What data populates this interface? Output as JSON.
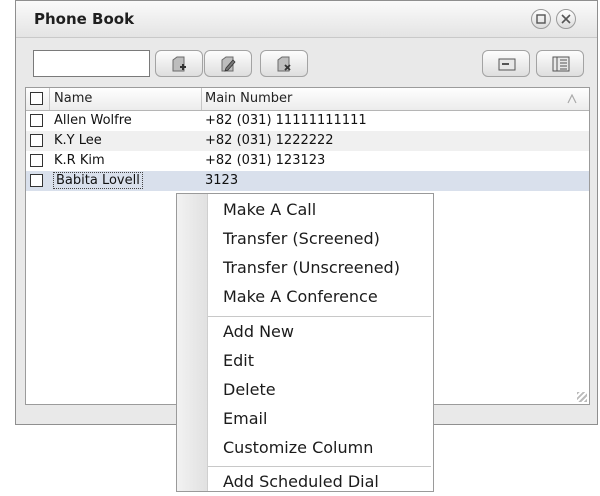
{
  "window": {
    "title": "Phone Book"
  },
  "titlebar_buttons": [
    {
      "name": "restore-button",
      "icon": "restore-icon"
    },
    {
      "name": "close-button",
      "icon": "close-icon"
    }
  ],
  "toolbar": {
    "search_value": "",
    "buttons": [
      {
        "name": "add-contact-button",
        "icon": "add-contact-icon"
      },
      {
        "name": "edit-contact-button",
        "icon": "edit-contact-icon"
      },
      {
        "name": "delete-contact-button",
        "icon": "delete-contact-icon"
      },
      {
        "name": "card-view-button",
        "icon": "card-view-icon"
      },
      {
        "name": "list-view-button",
        "icon": "list-view-icon"
      }
    ]
  },
  "grid": {
    "columns": [
      "Name",
      "Main Number"
    ],
    "rows": [
      {
        "name": "Allen Wolfre",
        "number": "+82 (031) 11111111111"
      },
      {
        "name": "K.Y Lee",
        "number": "+82 (031) 1222222"
      },
      {
        "name": "K.R Kim",
        "number": "+82 (031) 123123"
      },
      {
        "name": "Babita Lovell",
        "number": "3123"
      }
    ]
  },
  "context_menu": {
    "groups": [
      [
        "Make A Call",
        "Transfer (Screened)",
        "Transfer (Unscreened)",
        "Make A Conference"
      ],
      [
        "Add New",
        "Edit",
        "Delete",
        "Email",
        "Customize Column"
      ],
      [
        "Add Scheduled Dial"
      ]
    ]
  },
  "colors": {
    "selected_row": "#d9e0ec",
    "alt_row": "#f0f0f0"
  }
}
